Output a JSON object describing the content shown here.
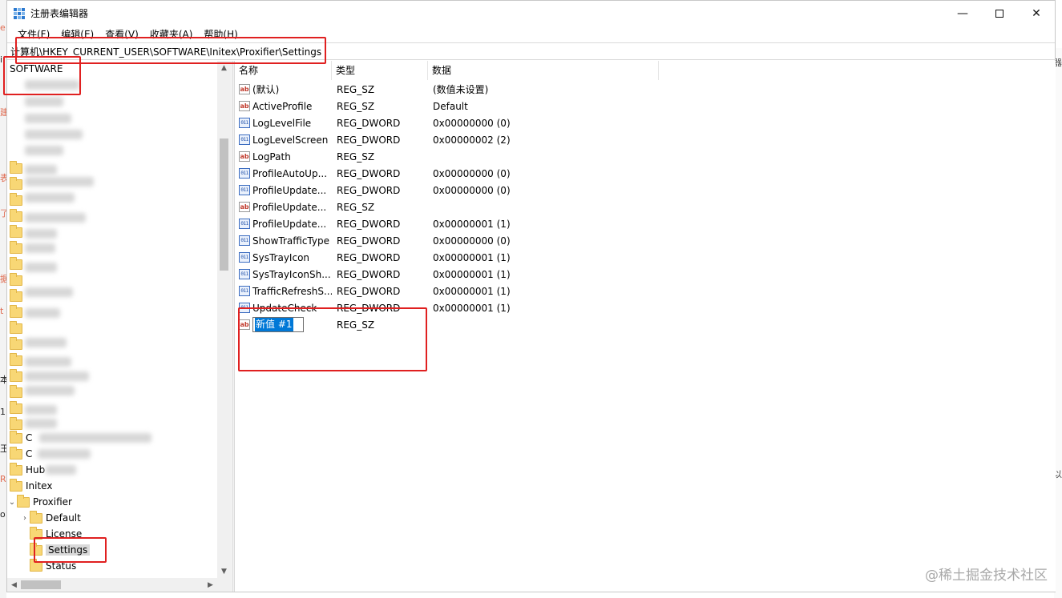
{
  "window": {
    "title": "注册表编辑器",
    "min_glyph": "—",
    "close_glyph": "✕"
  },
  "menu": [
    "文件(F)",
    "编辑(E)",
    "查看(V)",
    "收藏夹(A)",
    "帮助(H)"
  ],
  "address": {
    "value": "计算机\\HKEY_CURRENT_USER\\SOFTWARE\\Initex\\Proxifier\\Settings"
  },
  "tree": {
    "root_label": "SOFTWARE",
    "partial_items": [
      "C",
      "C",
      "Hub"
    ],
    "initex": "Initex",
    "proxifier": "Proxifier",
    "children": [
      "Default",
      "License",
      "Settings",
      "Status"
    ],
    "expand_glyph": "⌄",
    "collapsed_glyph": "›"
  },
  "list": {
    "columns": {
      "name": "名称",
      "type": "类型",
      "data": "数据"
    },
    "rows": [
      {
        "icon": "string-value-icon",
        "badge": "ab",
        "name": "(默认)",
        "type": "REG_SZ",
        "data": "(数值未设置)"
      },
      {
        "icon": "string-value-icon",
        "badge": "ab",
        "name": "ActiveProfile",
        "type": "REG_SZ",
        "data": "Default"
      },
      {
        "icon": "dword-value-icon",
        "badge": "011",
        "name": "LogLevelFile",
        "type": "REG_DWORD",
        "data": "0x00000000 (0)"
      },
      {
        "icon": "dword-value-icon",
        "badge": "011",
        "name": "LogLevelScreen",
        "type": "REG_DWORD",
        "data": "0x00000002 (2)"
      },
      {
        "icon": "string-value-icon",
        "badge": "ab",
        "name": "LogPath",
        "type": "REG_SZ",
        "data": ""
      },
      {
        "icon": "dword-value-icon",
        "badge": "011",
        "name": "ProfileAutoUp...",
        "type": "REG_DWORD",
        "data": "0x00000000 (0)"
      },
      {
        "icon": "dword-value-icon",
        "badge": "011",
        "name": "ProfileUpdate...",
        "type": "REG_DWORD",
        "data": "0x00000000 (0)"
      },
      {
        "icon": "string-value-icon",
        "badge": "ab",
        "name": "ProfileUpdate...",
        "type": "REG_SZ",
        "data": ""
      },
      {
        "icon": "dword-value-icon",
        "badge": "011",
        "name": "ProfileUpdate...",
        "type": "REG_DWORD",
        "data": "0x00000001 (1)"
      },
      {
        "icon": "dword-value-icon",
        "badge": "011",
        "name": "ShowTrafficType",
        "type": "REG_DWORD",
        "data": "0x00000000 (0)"
      },
      {
        "icon": "dword-value-icon",
        "badge": "011",
        "name": "SysTrayIcon",
        "type": "REG_DWORD",
        "data": "0x00000001 (1)"
      },
      {
        "icon": "dword-value-icon",
        "badge": "011",
        "name": "SysTrayIconSh...",
        "type": "REG_DWORD",
        "data": "0x00000001 (1)"
      },
      {
        "icon": "dword-value-icon",
        "badge": "011",
        "name": "TrafficRefreshS...",
        "type": "REG_DWORD",
        "data": "0x00000001 (1)"
      },
      {
        "icon": "dword-value-icon",
        "badge": "011",
        "name": "UpdateCheck",
        "type": "REG_DWORD",
        "data": "0x00000001 (1)"
      }
    ],
    "new_row": {
      "badge": "ab",
      "name": "新值 #1",
      "type": "REG_SZ",
      "data": ""
    }
  },
  "watermark": "@稀土掘金技术社区",
  "colors": {
    "annotation": "#e02020",
    "selection": "#0078d7",
    "folder": "#f8d775"
  }
}
